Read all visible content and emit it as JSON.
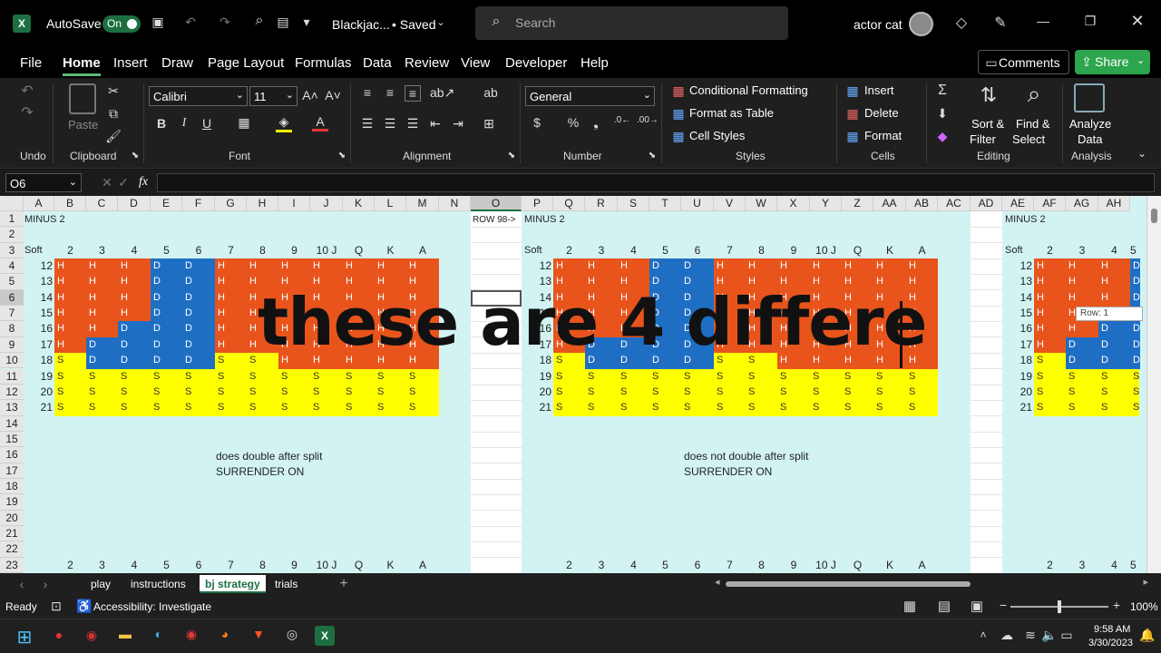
{
  "titlebar": {
    "autosave_label": "AutoSave",
    "autosave_state": "On",
    "file_title": "Blackjac...",
    "saved": "• Saved",
    "search_placeholder": "Search",
    "user": "actor cat"
  },
  "menu": [
    "File",
    "Home",
    "Insert",
    "Draw",
    "Page Layout",
    "Formulas",
    "Data",
    "Review",
    "View",
    "Developer",
    "Help"
  ],
  "menu_right": {
    "comments": "Comments",
    "share": "Share"
  },
  "ribbon": {
    "undo": "Undo",
    "paste": "Paste",
    "clipboard": "Clipboard",
    "font_name": "Calibri",
    "font_size": "11",
    "font": "Font",
    "alignment": "Alignment",
    "number_format": "General",
    "number": "Number",
    "cond_format": "Conditional Formatting",
    "format_table": "Format as Table",
    "cell_styles": "Cell Styles",
    "styles": "Styles",
    "insert": "Insert",
    "delete": "Delete",
    "format": "Format",
    "cells": "Cells",
    "sort_filter_1": "Sort &",
    "sort_filter_2": "Filter",
    "find_select_1": "Find &",
    "find_select_2": "Select",
    "editing": "Editing",
    "analyze_1": "Analyze",
    "analyze_2": "Data",
    "analysis": "Analysis"
  },
  "formula_bar": {
    "name_box": "O6",
    "fx": "fx"
  },
  "columns": [
    "A",
    "B",
    "C",
    "D",
    "E",
    "F",
    "G",
    "H",
    "I",
    "J",
    "K",
    "L",
    "M",
    "N",
    "O",
    "P",
    "Q",
    "R",
    "S",
    "T",
    "U",
    "V",
    "W",
    "X",
    "Y",
    "Z",
    "AA",
    "AB",
    "AC",
    "AD",
    "AE",
    "AF",
    "AG",
    "AH"
  ],
  "rows": [
    "1",
    "2",
    "3",
    "4",
    "5",
    "6",
    "7",
    "8",
    "9",
    "10",
    "11",
    "12",
    "13",
    "14",
    "15",
    "16",
    "17",
    "18",
    "19",
    "20",
    "21",
    "22",
    "23"
  ],
  "sheet": {
    "title_left": "MINUS 2",
    "title_mid": "MINUS 2",
    "title_right": "MINUS 2",
    "soft": "Soft",
    "row_ref": "ROW 98->",
    "upcards": [
      "2",
      "3",
      "4",
      "5",
      "6",
      "7",
      "8",
      "9",
      "10 J",
      "Q",
      "K",
      "A"
    ],
    "totals": [
      "12",
      "13",
      "14",
      "15",
      "16",
      "17",
      "18",
      "19",
      "20",
      "21"
    ],
    "note_left_1": "does double after split",
    "note_left_2": "SURRENDER ON",
    "note_mid_1": "does not double after split",
    "note_mid_2": "SURRENDER ON",
    "tooltip": "Row: 1"
  },
  "overlay_caption": "these are 4 differe",
  "sheet_tabs": [
    "play",
    "instructions",
    "bj strategy",
    "trials"
  ],
  "status": {
    "ready": "Ready",
    "accessibility": "Accessibility: Investigate",
    "zoom": "100%"
  },
  "taskbar": {
    "time": "9:58 AM",
    "date": "3/30/2023"
  },
  "colors": {
    "hit": "#e8541c",
    "double": "#1e6fc4",
    "stand": "#ffff00",
    "bg": "#d3f3f3",
    "share": "#2da44e"
  }
}
